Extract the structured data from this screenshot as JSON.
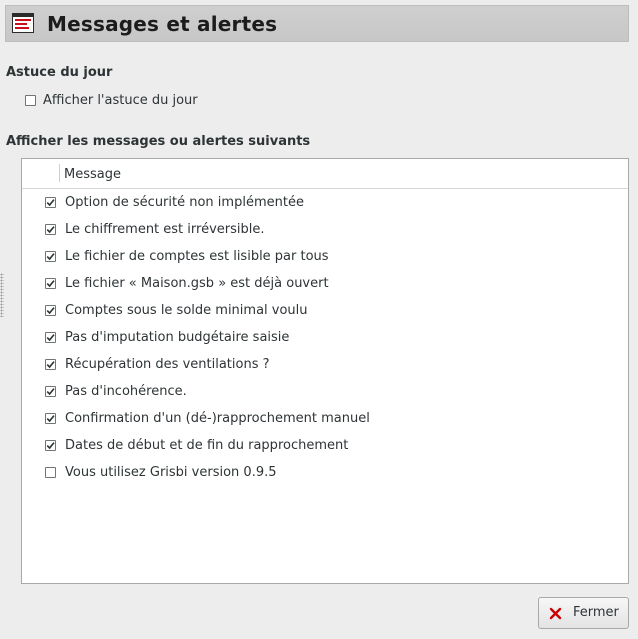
{
  "header": {
    "title": "Messages et alertes",
    "icon": "messages-dialog-icon"
  },
  "tip_section": {
    "title": "Astuce du jour",
    "checkbox_label": "Afficher l'astuce du jour",
    "checked": false
  },
  "messages_section": {
    "title": "Afficher les messages ou alertes suivants",
    "column_header": "Message",
    "rows": [
      {
        "label": "Option de sécurité non implémentée",
        "checked": true
      },
      {
        "label": "Le chiffrement est irréversible.",
        "checked": true
      },
      {
        "label": "Le fichier de comptes est lisible par tous",
        "checked": true
      },
      {
        "label": "Le fichier « Maison.gsb » est déjà ouvert",
        "checked": true
      },
      {
        "label": "Comptes sous le solde minimal voulu",
        "checked": true
      },
      {
        "label": "Pas d'imputation budgétaire saisie",
        "checked": true
      },
      {
        "label": "Récupération des ventilations ?",
        "checked": true
      },
      {
        "label": "Pas d'incohérence.",
        "checked": true
      },
      {
        "label": "Confirmation d'un (dé-)rapprochement manuel",
        "checked": true
      },
      {
        "label": "Dates de début et de fin du rapprochement",
        "checked": true
      },
      {
        "label": "Vous utilisez Grisbi version 0.9.5",
        "checked": false
      }
    ]
  },
  "footer": {
    "close_label": "Fermer",
    "close_icon": "close-x-icon"
  },
  "colors": {
    "titlebar": "#cfcfcf",
    "background": "#ededed",
    "text": "#2e3436",
    "close_icon": "#cc0000"
  }
}
